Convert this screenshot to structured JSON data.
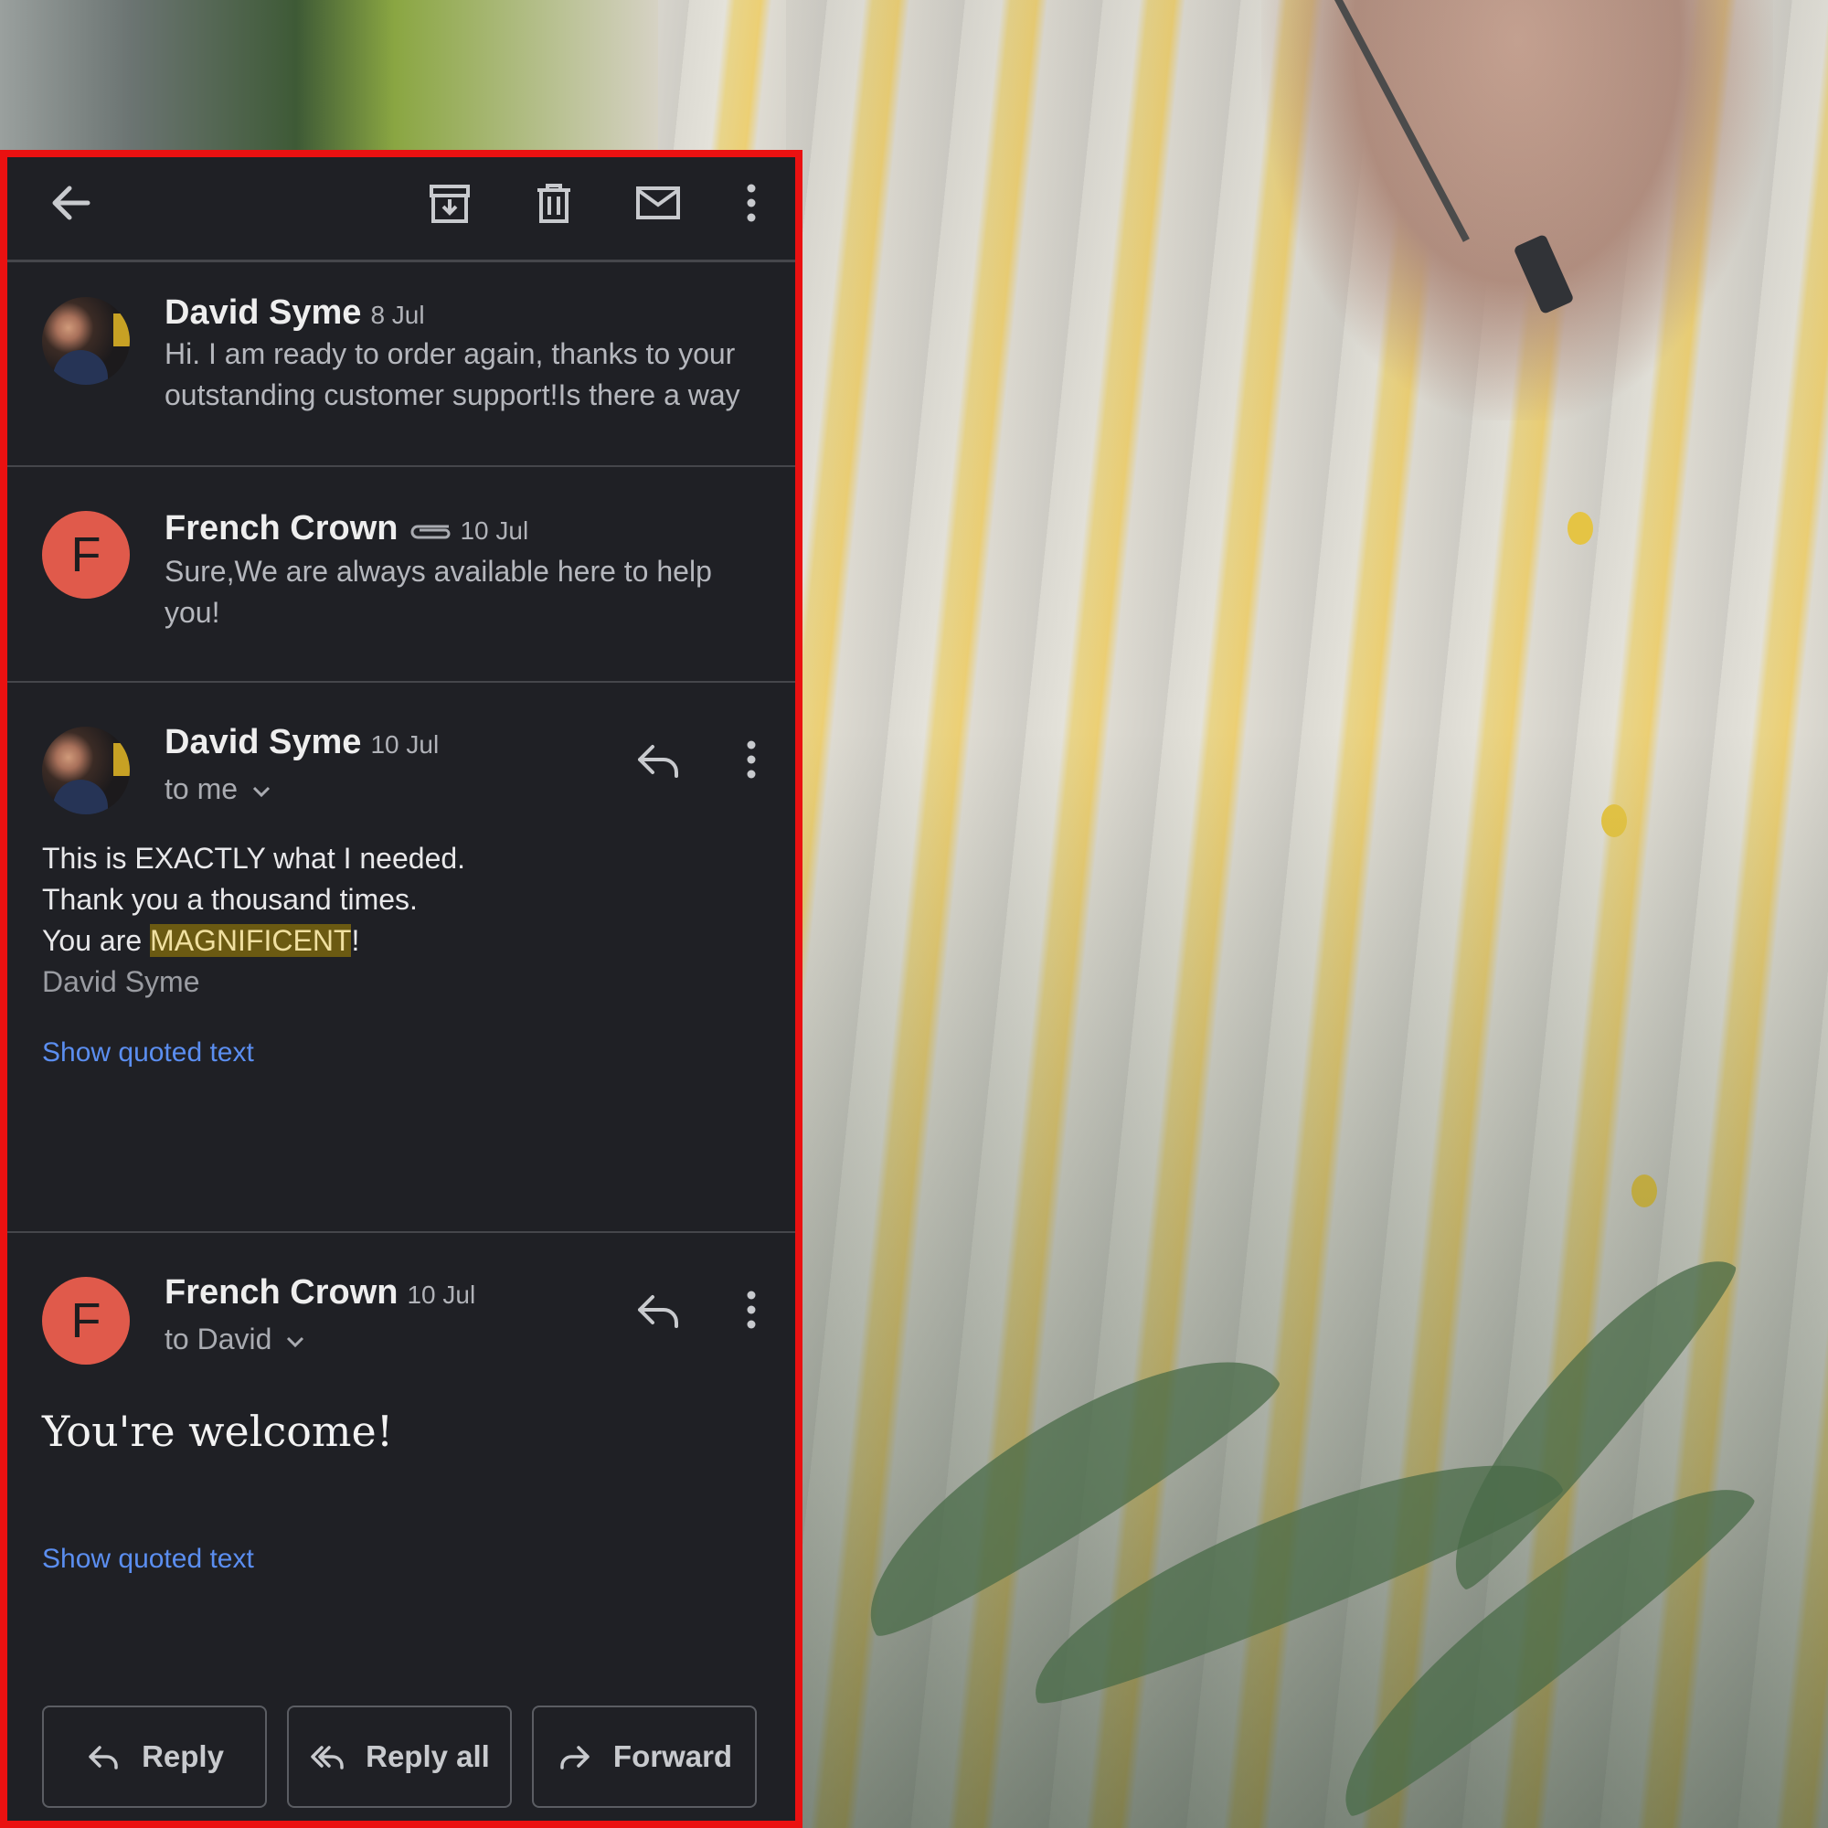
{
  "toolbar": {
    "back": "back-arrow-icon",
    "archive": "archive-icon",
    "delete": "trash-icon",
    "mark_unread": "mail-icon",
    "more": "more-vert-icon"
  },
  "messages": [
    {
      "sender": "David Syme",
      "date": "8 Jul",
      "snippet": "Hi. I am ready to order again, thanks to your outstanding customer support!Is there a way"
    },
    {
      "sender": "French Crown",
      "avatar_letter": "F",
      "date": "10 Jul",
      "snippet": "Sure,We are always available here to help you!",
      "has_attachment": true
    },
    {
      "sender": "David Syme",
      "date": "10 Jul",
      "recipient": "to me",
      "body": {
        "line1": "This is EXACTLY what I needed.",
        "line2": "Thank you a thousand times.",
        "line3_pre": "You are ",
        "line3_highlight": "MAGNIFICENT",
        "line3_post": "!",
        "signature": "David Syme"
      },
      "show_quoted": "Show quoted text"
    },
    {
      "sender": "French Crown",
      "avatar_letter": "F",
      "date": "10 Jul",
      "recipient": "to David",
      "body": "You're welcome!",
      "show_quoted": "Show quoted text"
    }
  ],
  "actions": {
    "reply": "Reply",
    "reply_all": "Reply all",
    "forward": "Forward"
  },
  "colors": {
    "frame": "#ea1111",
    "background": "#1f2025",
    "avatar": "#e05a4b",
    "link": "#5b8ef0",
    "highlight": "#6b5a12"
  }
}
